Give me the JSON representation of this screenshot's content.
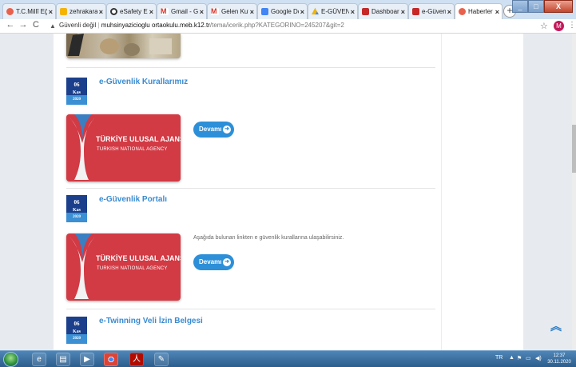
{
  "browser": {
    "tabs": [
      {
        "label": "T.C.Millî Eğ",
        "color": "#e8614c"
      },
      {
        "label": "zehrakaral",
        "color": "#f4b400"
      },
      {
        "label": "eSafety Eb",
        "color": "#333333"
      },
      {
        "label": "Gmail - Ge",
        "color": "#d93025"
      },
      {
        "label": "Gelen Kutu",
        "color": "#d93025"
      },
      {
        "label": "Google Dc",
        "color": "#4285f4"
      },
      {
        "label": "E-GÜVENL",
        "color": "#0f9d58"
      },
      {
        "label": "Dashboard",
        "color": "#c62828"
      },
      {
        "label": "e-Güvenli",
        "color": "#c62828"
      },
      {
        "label": "Haberler -",
        "color": "#e8614c"
      }
    ],
    "new_tab": "+",
    "address": {
      "security_label": "Güvenli değil",
      "host": "muhsinyazicioglu ortaokulu.meb.k12.tr",
      "path": "/tema/icerik.php?KATEGORINO=245207&git=2"
    },
    "profile_initial": "M"
  },
  "posts": [
    {
      "day": "06",
      "month": "Kas",
      "year": "2020",
      "title": "e-Güvenlik Kurallarımız",
      "image_title": "TÜRKİYE ULUSAL AJANSI",
      "image_subtitle": "TURKISH NATIONAL AGENCY",
      "excerpt": "",
      "more_label": "Devamı"
    },
    {
      "day": "06",
      "month": "Kas",
      "year": "2020",
      "title": "e-Güvenlik Portalı",
      "image_title": "TÜRKİYE ULUSAL AJANSI",
      "image_subtitle": "TURKISH NATIONAL AGENCY",
      "excerpt": "Aşağıda bulunan linkten e güvenlik kurallarına ulaşabilirsiniz.",
      "more_label": "Devamı"
    },
    {
      "day": "06",
      "month": "Kas",
      "year": "2020",
      "title": "e-Twinning Veli İzin Belgesi"
    }
  ],
  "scroll_top_icon": "double-chevron-up-icon",
  "taskbar": {
    "language": "TR",
    "time": "12:37",
    "date": "30.11.2020"
  }
}
